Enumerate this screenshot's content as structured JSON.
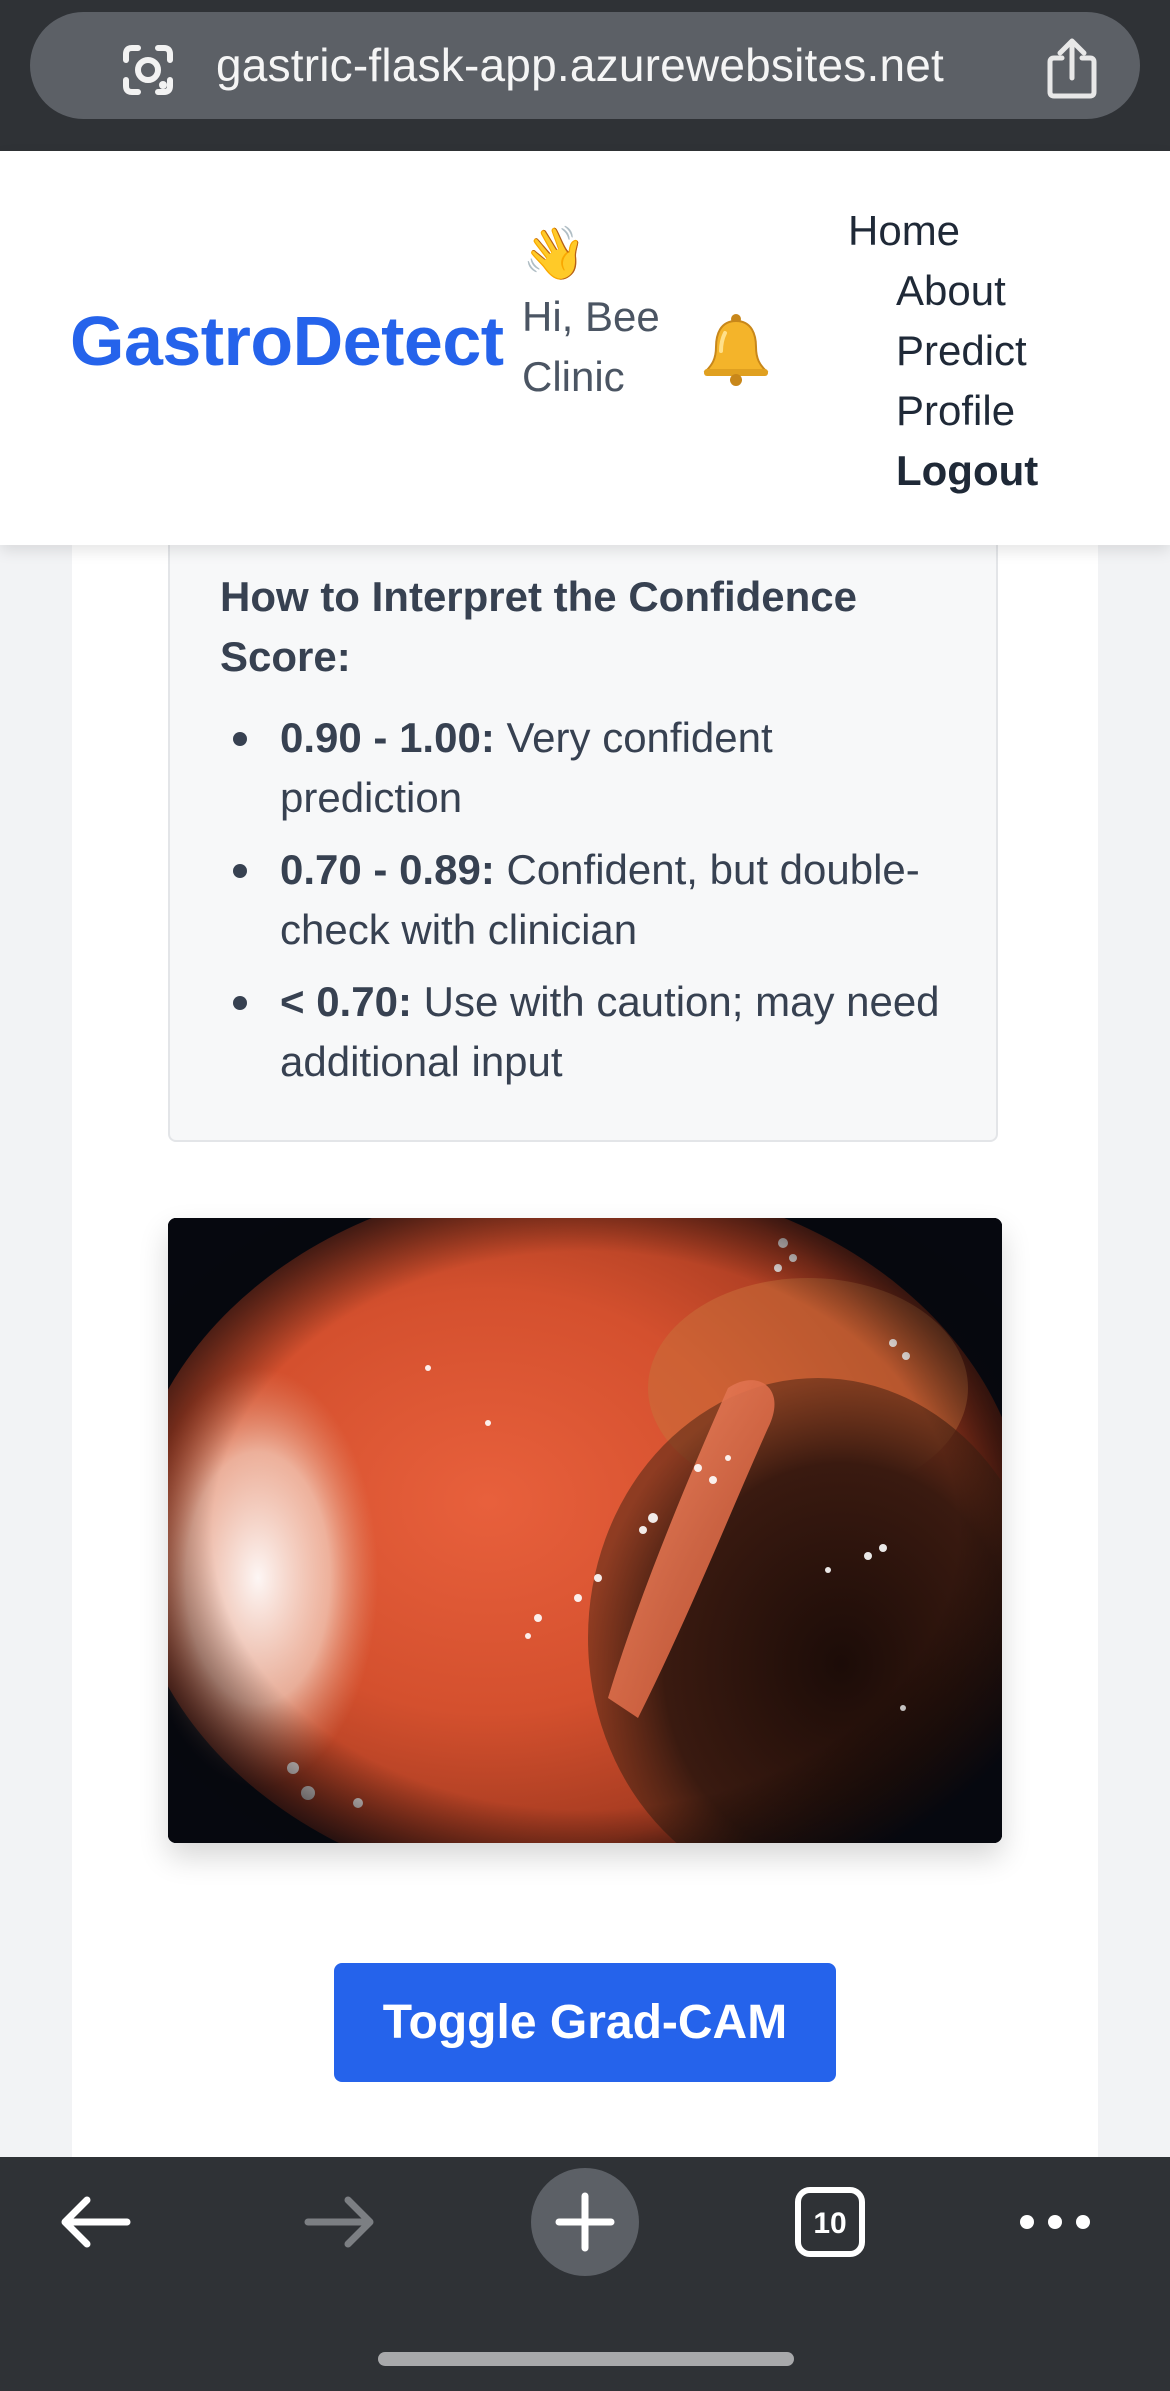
{
  "browser": {
    "url": "gastric-flask-app.azurewebsites.net",
    "tab_count": "10"
  },
  "nav": {
    "brand": "GastroDetect",
    "greeting_emoji": "👋",
    "greeting_text": "Hi, Bee Clinic",
    "links": [
      "Home",
      "About",
      "Predict",
      "Profile",
      "Logout"
    ]
  },
  "confidence_info": {
    "title": "How to Interpret the Confidence Score:",
    "items": [
      {
        "range": "0.90 - 1.00:",
        "text": " Very confident prediction"
      },
      {
        "range": "0.70 - 0.89:",
        "text": " Confident, but double-check with clinician"
      },
      {
        "range": "< 0.70:",
        "text": " Use with caution; may need additional input"
      }
    ]
  },
  "actions": {
    "toggle_label": "Toggle Grad-CAM"
  },
  "colors": {
    "brand": "#2563eb",
    "button": "#2563eb",
    "browser_chrome": "#2f3236"
  }
}
